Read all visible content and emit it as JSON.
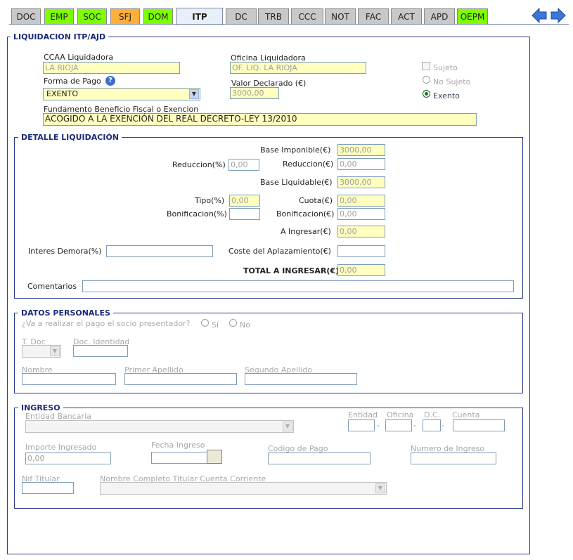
{
  "tabs": [
    {
      "label": "DOC",
      "style": "gray"
    },
    {
      "label": "EMP",
      "style": "green"
    },
    {
      "label": "SOC",
      "style": "green"
    },
    {
      "label": "SFJ",
      "style": "orange"
    },
    {
      "label": "DOM",
      "style": "green"
    },
    {
      "label": "ITP",
      "style": "active"
    },
    {
      "label": "DC",
      "style": "gray"
    },
    {
      "label": "TRB",
      "style": "gray"
    },
    {
      "label": "CCC",
      "style": "gray"
    },
    {
      "label": "NOT",
      "style": "gray"
    },
    {
      "label": "FAC",
      "style": "gray"
    },
    {
      "label": "ACT",
      "style": "gray"
    },
    {
      "label": "APD",
      "style": "gray"
    },
    {
      "label": "OEPM",
      "style": "green"
    }
  ],
  "nav": {
    "back_icon": "arrow-left-icon",
    "forward_icon": "arrow-right-icon",
    "accent": "#3a78d8"
  },
  "liquidacion": {
    "legend": "LIQUIDACION ITP/AJD",
    "ccaa_label": "CCAA Liquidadora",
    "ccaa_value": "LA RIOJA",
    "oficina_label": "Oficina Liquidadora",
    "oficina_value": "OF. LIQ. LA RIOJA",
    "forma_pago_label": "Forma de Pago",
    "forma_pago_value": "EXENTO",
    "valor_label": "Valor Declarado (€)",
    "valor_value": "3000,00",
    "fundamento_label": "Fundamento Beneficio Fiscal o Exencion",
    "fundamento_value": "ACOGIDO A LA EXENCIÓN DEL REAL DECRETO-LEY 13/2010",
    "sujeto_label": "Sujeto",
    "no_sujeto_label": "No Sujeto",
    "exento_label": "Exento",
    "help_icon": "?"
  },
  "detalle": {
    "legend": "DETALLE LIQUIDACIÓN",
    "base_imponible_label": "Base Imponible(€)",
    "base_imponible_value": "3000,00",
    "reduccion_pct_label": "Reduccion(%)",
    "reduccion_pct_value": "0,00",
    "reduccion_eur_label": "Reduccion(€)",
    "reduccion_eur_value": "0,00",
    "base_liquidable_label": "Base Liquidable(€)",
    "base_liquidable_value": "3000,00",
    "tipo_label": "Tipo(%)",
    "tipo_value": "0,00",
    "cuota_label": "Cuota(€)",
    "cuota_value": "0,00",
    "bonif_pct_label": "Bonificacion(%)",
    "bonif_pct_value": "",
    "bonif_eur_label": "Bonificacion(€)",
    "bonif_eur_value": "0,00",
    "a_ingresar_label": "A Ingresar(€)",
    "a_ingresar_value": "0,00",
    "interes_label": "Interes Demora(%)",
    "interes_value": "",
    "coste_label": "Coste del Aplazamiento(€)",
    "coste_value": "",
    "total_label": "TOTAL A INGRESAR(€)",
    "total_value": "0,00",
    "comentarios_label": "Comentarios",
    "comentarios_value": ""
  },
  "personales": {
    "legend": "DATOS PERSONALES",
    "pregunta": "¿Va a realizar el pago el socio presentador?",
    "si_label": "Sí",
    "no_label": "No",
    "tdoc_label": "T. Doc",
    "docid_label": "Doc. Identidad",
    "nombre_label": "Nombre",
    "apellido1_label": "Primer Apellido",
    "apellido2_label": "Segundo Apellido"
  },
  "ingreso": {
    "legend": "INGRESO",
    "entidad_bancaria_label": "Entidad Bancaria",
    "entidad_label": "Entidad",
    "oficina_label": "Oficina",
    "dc_label": "D.C.",
    "cuenta_label": "Cuenta",
    "importe_label": "Importe Ingresado",
    "importe_value": "0,00",
    "fecha_label": "Fecha Ingreso",
    "codigo_label": "Codigo de Pago",
    "numero_label": "Numero de Ingreso",
    "nif_label": "Nif Titular",
    "nombre_titular_label": "Nombre Completo Titular Cuenta Corriente",
    "separator": "-"
  }
}
